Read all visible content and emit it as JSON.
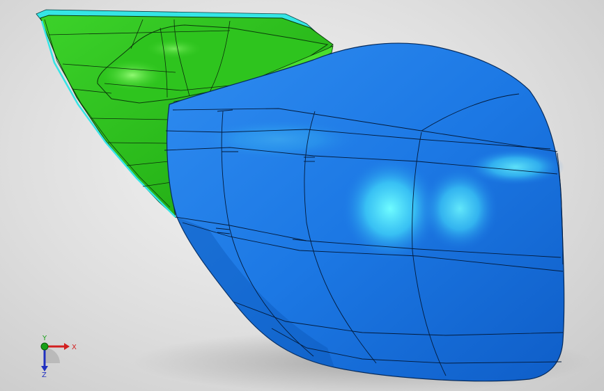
{
  "viewport": {
    "background_color": "#dcdcdc",
    "part_colors": {
      "shell": "#1e7ae6",
      "shell_highlight": "#5cf0ff",
      "cover": "#2bbd1a",
      "cover_edge": "#35e5e5"
    }
  },
  "triad": {
    "x_label": "X",
    "y_label": "Y",
    "z_label": "Z",
    "x_color": "#d22020",
    "y_color": "#18a018",
    "z_color": "#2030c0"
  }
}
